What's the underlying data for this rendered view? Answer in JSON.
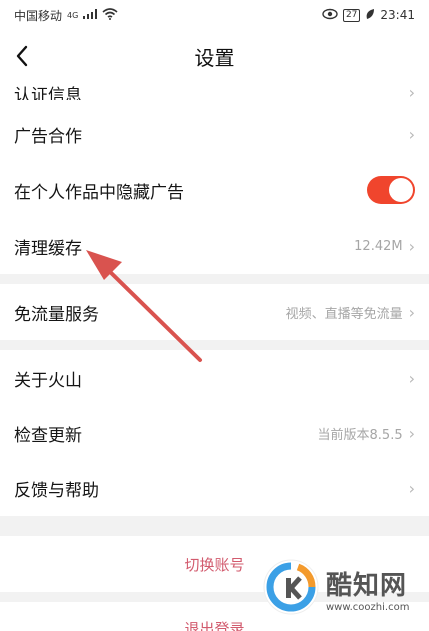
{
  "status_bar": {
    "carrier": "中国移动",
    "network": "4G",
    "battery": "27",
    "time": "23:41"
  },
  "nav": {
    "back_icon": "chevron-left-icon",
    "title": "设置"
  },
  "rows": {
    "cert_info": {
      "label": "认证信息"
    },
    "ad_partner": {
      "label": "广告合作"
    },
    "hide_ads": {
      "label": "在个人作品中隐藏广告",
      "toggle_on": true
    },
    "clear_cache": {
      "label": "清理缓存",
      "value": "12.42M"
    },
    "free_data": {
      "label": "免流量服务",
      "value": "视频、直播等免流量"
    },
    "about": {
      "label": "关于火山"
    },
    "check_update": {
      "label": "检查更新",
      "value": "当前版本8.5.5"
    },
    "feedback": {
      "label": "反馈与帮助"
    }
  },
  "buttons": {
    "switch_account": "切换账号",
    "logout": "退出登录"
  },
  "watermark": {
    "title": "酷知网",
    "url": "www.coozhi.com"
  },
  "colors": {
    "toggle_on": "#f0452d",
    "accent_text": "#d25b6e",
    "annotation_arrow": "#d9534f"
  }
}
